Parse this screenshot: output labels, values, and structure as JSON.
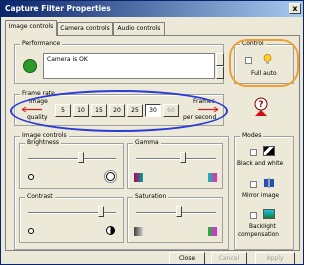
{
  "window": {
    "title": "Capture Filter Properties",
    "close_glyph": "x"
  },
  "tabs": [
    "Image controls",
    "Camera controls",
    "Audio controls"
  ],
  "performance": {
    "label": "Performance",
    "status_text": "Camera is OK",
    "indicator_color": "#2b9a2b"
  },
  "control": {
    "label": "Control",
    "full_auto_label": "Full auto",
    "full_auto_checked": false
  },
  "frame_rate": {
    "label": "Frame rate",
    "left_top": "Image",
    "left_bottom": "quality",
    "right_top": "Frames",
    "right_bottom": "per second",
    "rates": [
      "5",
      "10",
      "15",
      "20",
      "25",
      "30",
      "60"
    ],
    "selected": "30",
    "disabled": "60"
  },
  "image_controls": {
    "label": "Image controls",
    "brightness": "Brightness",
    "gamma": "Gamma",
    "contrast": "Contrast",
    "saturation": "Saturation"
  },
  "modes": {
    "label": "Modes",
    "black_and_white": "Black and white",
    "mirror_image": "Mirror image",
    "backlight_line1": "Backlight",
    "backlight_line2": "compensation"
  },
  "footer": {
    "close": "Close",
    "cancel": "Cancel",
    "apply": "Apply"
  },
  "colors": {
    "annotation_blue": "#2a3bd6",
    "annotation_orange": "#f0a030"
  }
}
